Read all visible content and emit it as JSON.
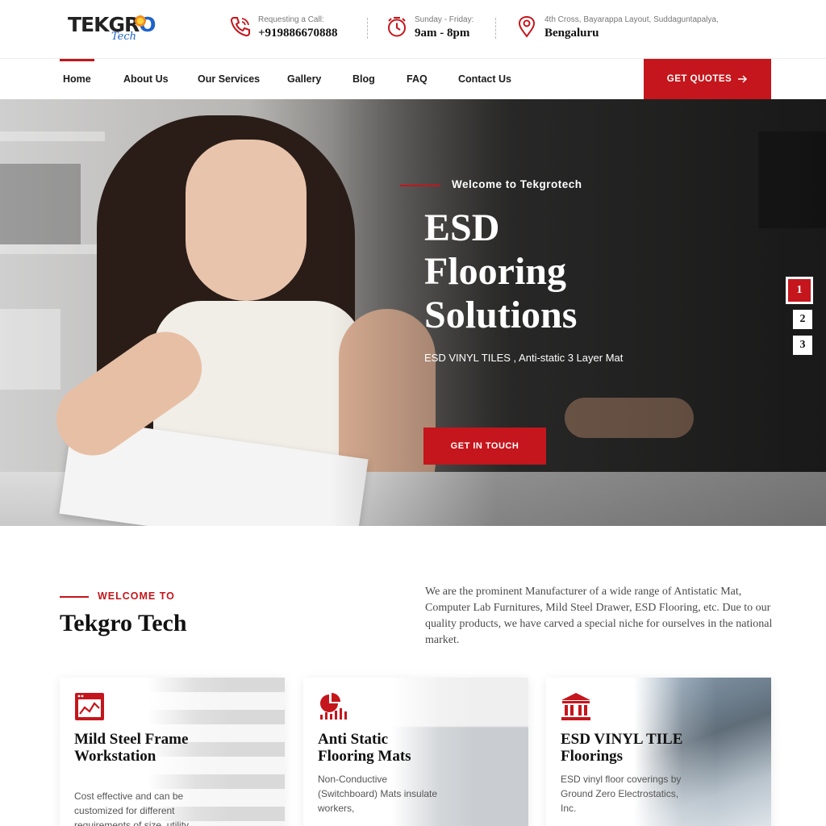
{
  "brand": {
    "logo_main_a": "TEKGR",
    "logo_main_b": "O",
    "logo_sub": "Tech"
  },
  "contact": {
    "call_label": "Requesting a Call:",
    "call_value": "+919886670888",
    "hours_label": "Sunday - Friday:",
    "hours_value": "9am - 8pm",
    "address_label": "4th Cross, Bayarappa Layout, Suddaguntapalya,",
    "address_value": "Bengaluru"
  },
  "nav": {
    "items": [
      {
        "label": "Home",
        "active": true
      },
      {
        "label": "About Us"
      },
      {
        "label": "Our Services"
      },
      {
        "label": "Gallery"
      },
      {
        "label": "Blog"
      },
      {
        "label": "FAQ"
      },
      {
        "label": "Contact Us"
      }
    ],
    "cta_label": "GET QUOTES",
    "cta_icon": "arrow-right-icon"
  },
  "hero": {
    "kicker": "Welcome to Tekgrotech",
    "title": "ESD Flooring Solutions",
    "subtitle": "ESD VINYL TILES , Anti-static 3 Layer Mat",
    "button_label": "GET IN TOUCH",
    "slides": [
      "1",
      "2",
      "3"
    ],
    "active_slide": "1"
  },
  "welcome": {
    "kicker": "WELCOME TO",
    "title": "Tekgro Tech",
    "text": "We are the prominent Manufacturer of a wide range of Antistatic Mat, Computer Lab Furnitures, Mild Steel Drawer, ESD Flooring, etc. Due to our quality products, we have carved a special niche for ourselves in the national market."
  },
  "cards": [
    {
      "icon": "chart-window-icon",
      "title": "Mild Steel Frame Workstation",
      "text": "Cost effective and can be customized for different requirements of size, utility"
    },
    {
      "icon": "pie-bar-chart-icon",
      "title": "Anti Static Flooring Mats",
      "text": "Non-Conductive (Switchboard) Mats insulate workers,"
    },
    {
      "icon": "bank-building-icon",
      "title": "ESD VINYL TILE Floorings",
      "text": "ESD vinyl floor coverings by Ground Zero Electrostatics, Inc."
    }
  ],
  "colors": {
    "accent": "#c4161c",
    "text_dark": "#111111",
    "logo_blue": "#1d63c9"
  }
}
